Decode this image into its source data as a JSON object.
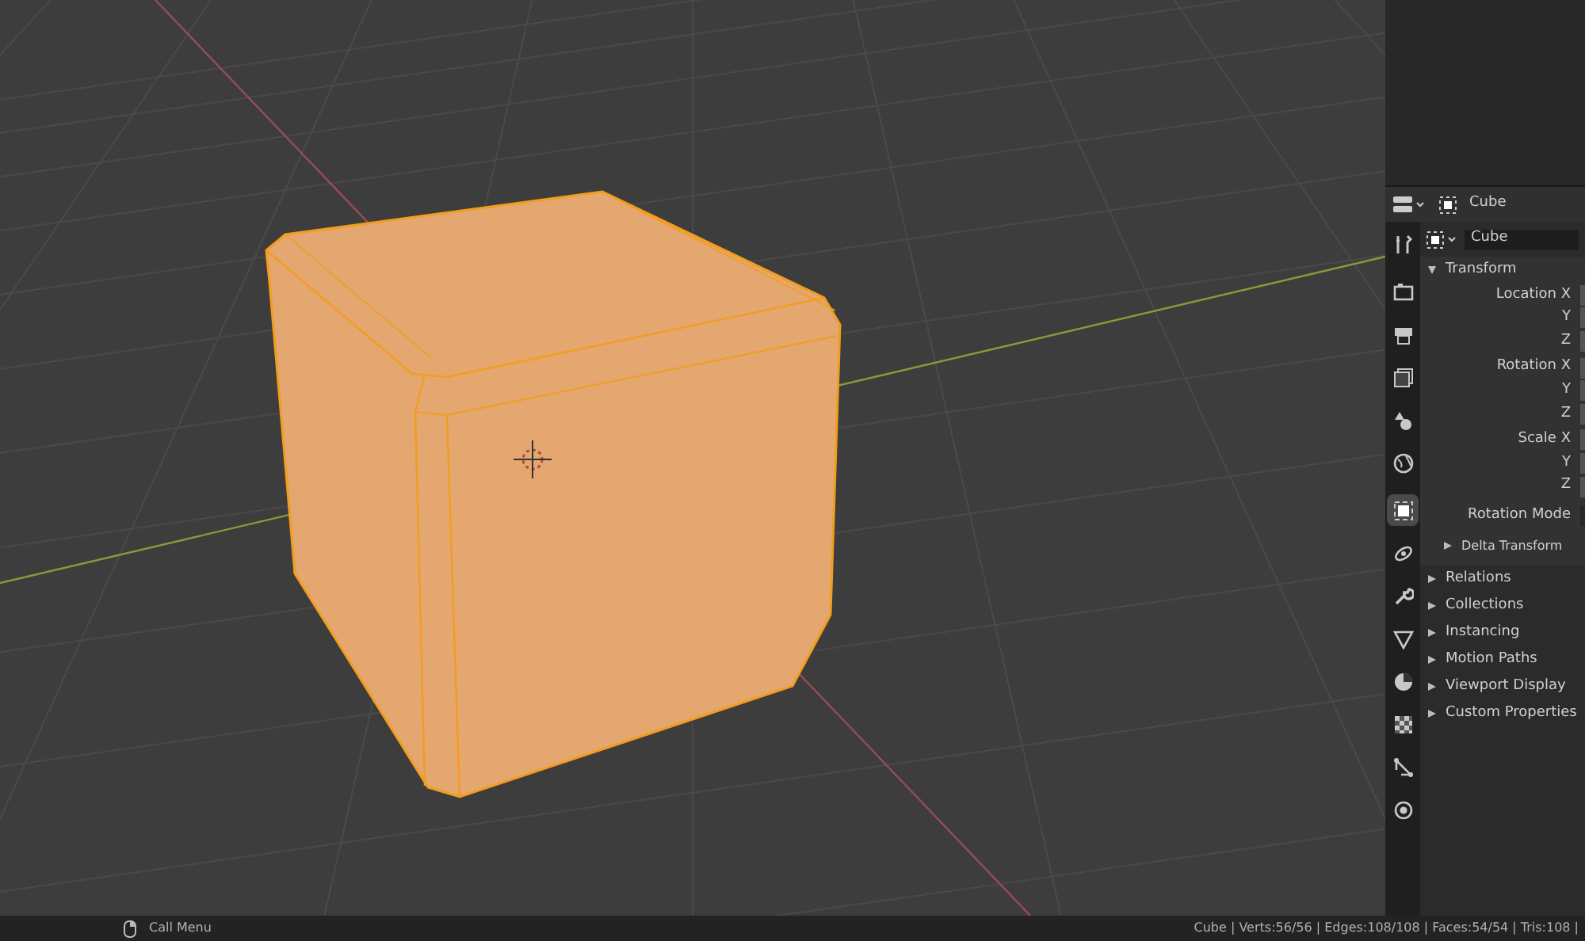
{
  "properties": {
    "header": {
      "object_name": "Cube"
    },
    "tabs": [
      {
        "kind": "tool",
        "selected": false
      },
      {
        "kind": "render",
        "selected": false
      },
      {
        "kind": "output",
        "selected": false
      },
      {
        "kind": "view_layer",
        "selected": false
      },
      {
        "kind": "scene",
        "selected": false
      },
      {
        "kind": "world",
        "selected": false
      },
      {
        "kind": "object",
        "selected": true
      },
      {
        "kind": "particles",
        "selected": false
      },
      {
        "kind": "modifiers",
        "selected": false
      },
      {
        "kind": "data",
        "selected": false
      },
      {
        "kind": "material",
        "selected": false
      },
      {
        "kind": "texture",
        "selected": false
      },
      {
        "kind": "constraints",
        "selected": false
      },
      {
        "kind": "physics",
        "selected": false
      }
    ],
    "name_field": {
      "value": "Cube"
    },
    "panels": [
      {
        "title": "Transform",
        "expanded": true,
        "rows": [
          "Location X",
          "Y",
          "Z",
          "Rotation X",
          "Y",
          "Z",
          "Scale X",
          "Y",
          "Z"
        ],
        "mode_label": "Rotation Mode",
        "children": [
          {
            "title": "Delta Transform",
            "expanded": false
          }
        ]
      },
      {
        "title": "Relations",
        "expanded": false
      },
      {
        "title": "Collections",
        "expanded": false
      },
      {
        "title": "Instancing",
        "expanded": false
      },
      {
        "title": "Motion Paths",
        "expanded": false
      },
      {
        "title": "Viewport Display",
        "expanded": false
      },
      {
        "title": "Custom Properties",
        "expanded": false
      }
    ]
  },
  "status_bar": {
    "hint": "Call Menu",
    "stats": "Cube | Verts:56/56 | Edges:108/108 | Faces:54/54 | Tris:108 |"
  }
}
